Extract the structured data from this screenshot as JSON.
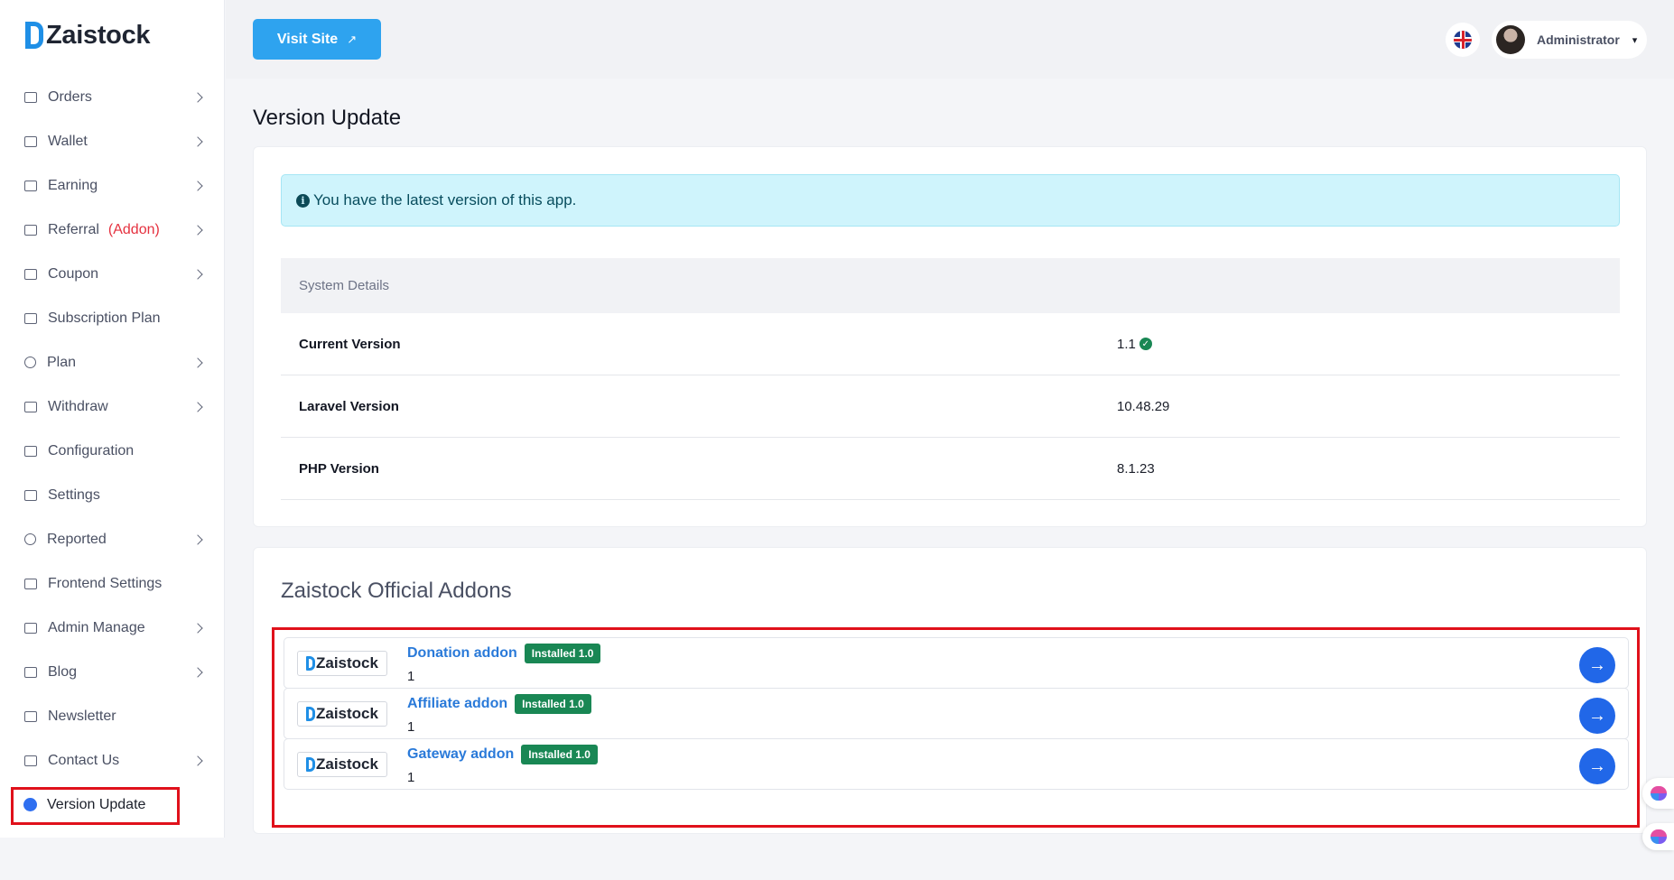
{
  "app": {
    "name": "Zaistock"
  },
  "topbar": {
    "visit_label": "Visit Site",
    "visit_icon": "↗",
    "user_name": "Administrator",
    "caret": "▾"
  },
  "sidebar": {
    "items": [
      {
        "label": "Orders",
        "icon": "cart-icon",
        "chevron": true
      },
      {
        "label": "Wallet",
        "icon": "wallet-icon",
        "chevron": true
      },
      {
        "label": "Earning",
        "icon": "money-icon",
        "chevron": true
      },
      {
        "label": "Referral",
        "badge": "(Addon)",
        "icon": "share-icon",
        "chevron": true
      },
      {
        "label": "Coupon",
        "icon": "ticket-icon",
        "chevron": true
      },
      {
        "label": "Subscription Plan",
        "icon": "box-icon",
        "chevron": false
      },
      {
        "label": "Plan",
        "icon": "coin-icon",
        "chevron": true
      },
      {
        "label": "Withdraw",
        "icon": "bag-icon",
        "chevron": true
      },
      {
        "label": "Configuration",
        "icon": "gear-box-icon",
        "chevron": false
      },
      {
        "label": "Settings",
        "icon": "gear-box-icon",
        "chevron": false
      },
      {
        "label": "Reported",
        "icon": "alert-icon",
        "chevron": true
      },
      {
        "label": "Frontend Settings",
        "icon": "layout-icon",
        "chevron": false
      },
      {
        "label": "Admin Manage",
        "icon": "admin-icon",
        "chevron": true
      },
      {
        "label": "Blog",
        "icon": "blog-icon",
        "chevron": true
      },
      {
        "label": "Newsletter",
        "icon": "newsletter-icon",
        "chevron": false
      },
      {
        "label": "Contact Us",
        "icon": "contact-icon",
        "chevron": true
      },
      {
        "label": "Version Update",
        "icon": "dot-icon",
        "chevron": false,
        "active": true
      }
    ]
  },
  "main": {
    "title": "Version Update",
    "alert": {
      "icon": "i",
      "text": "You have the latest version of this app."
    },
    "system": {
      "header": "System Details",
      "rows": [
        {
          "key": "Current Version",
          "value": "1.1",
          "verified": true
        },
        {
          "key": "Laravel Version",
          "value": "10.48.29"
        },
        {
          "key": "PHP Version",
          "value": "8.1.23"
        }
      ]
    },
    "addons": {
      "title": "Zaistock Official Addons",
      "items": [
        {
          "logo": "Zaistock",
          "name": "Donation addon",
          "badge": "Installed 1.0",
          "desc": "1"
        },
        {
          "logo": "Zaistock",
          "name": "Affiliate addon",
          "badge": "Installed 1.0",
          "desc": "1"
        },
        {
          "logo": "Zaistock",
          "name": "Gateway addon",
          "badge": "Installed 1.0",
          "desc": "1"
        }
      ]
    }
  },
  "colors": {
    "accent": "#2ea3ef",
    "primary_button": "#2167e8",
    "success": "#198754",
    "highlight": "#e0111b",
    "addon_badge_text": "#e5313f"
  }
}
